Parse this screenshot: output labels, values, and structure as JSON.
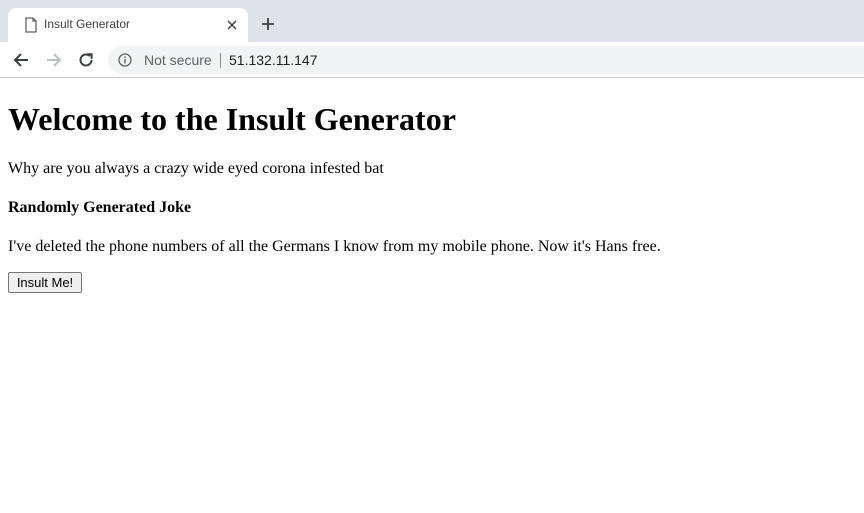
{
  "browser": {
    "tab_title": "Insult Generator",
    "security_label": "Not secure",
    "url": "51.132.11.147"
  },
  "page": {
    "heading": "Welcome to the Insult Generator",
    "insult": "Why are you always a crazy wide eyed corona infested bat",
    "joke_heading": "Randomly Generated Joke",
    "joke": "I've deleted the phone numbers of all the Germans I know from my mobile phone. Now it's Hans free.",
    "button_label": "Insult Me!"
  }
}
